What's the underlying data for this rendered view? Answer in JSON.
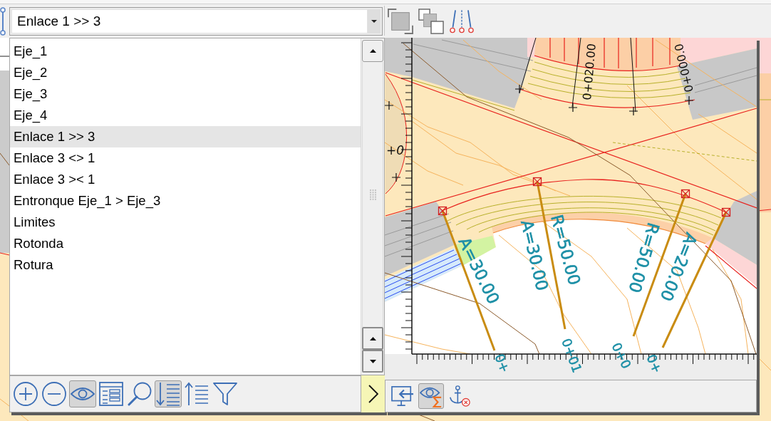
{
  "toolbar": {
    "alignment_combobox": {
      "value": "Enlace 1 >> 3",
      "expanded": true
    }
  },
  "alignment_list": {
    "items": [
      {
        "label": "Eje_1",
        "selected": false
      },
      {
        "label": "Eje_2",
        "selected": false
      },
      {
        "label": "Eje_3",
        "selected": false
      },
      {
        "label": "Eje_4",
        "selected": false
      },
      {
        "label": "Enlace 1 >> 3",
        "selected": true
      },
      {
        "label": "Enlace 3 <> 1",
        "selected": false
      },
      {
        "label": "Enlace 3 >< 1",
        "selected": false
      },
      {
        "label": "Entronque Eje_1 > Eje_3",
        "selected": false
      },
      {
        "label": "Limites",
        "selected": false
      },
      {
        "label": "Rotonda",
        "selected": false
      },
      {
        "label": "Rotura",
        "selected": false
      }
    ]
  },
  "list_toolbar": {
    "buttons": [
      {
        "kind": "add",
        "pressed": false
      },
      {
        "kind": "remove",
        "pressed": false
      },
      {
        "kind": "view",
        "pressed": true
      },
      {
        "kind": "details",
        "pressed": false
      },
      {
        "kind": "find",
        "pressed": false
      },
      {
        "kind": "sort_down",
        "pressed": true
      },
      {
        "kind": "sort_up",
        "pressed": false
      },
      {
        "kind": "filter",
        "pressed": false
      }
    ]
  },
  "preview_map": {
    "top_station_labels": [
      "0+020.00",
      "0+000.0"
    ],
    "side_station_label": "+0",
    "curve_labels": [
      "A=30.00",
      "A=30.00",
      "R=50.00",
      "R=50.00",
      "A=20.00"
    ],
    "bottom_station_labels": [
      "0+",
      "0+01",
      "0+0",
      "0+"
    ]
  },
  "preview_toolbar": {
    "buttons": [
      {
        "kind": "import",
        "pressed": false
      },
      {
        "kind": "totals_view",
        "pressed": true
      },
      {
        "kind": "remove_anchor",
        "pressed": false
      }
    ]
  }
}
